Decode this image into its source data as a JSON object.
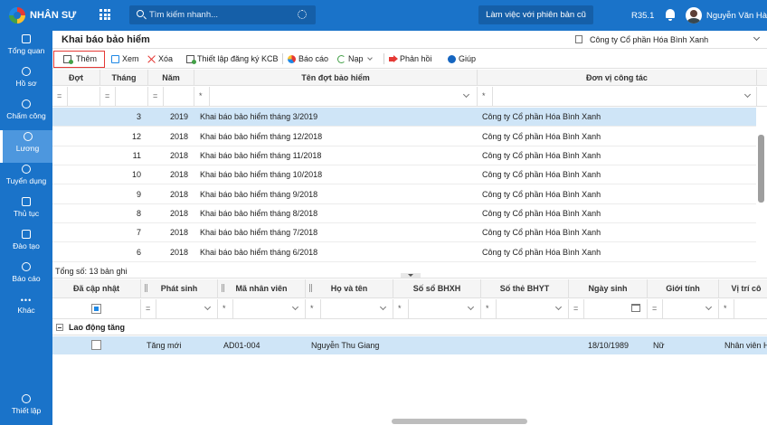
{
  "app": {
    "brand": "NHÂN SỰ",
    "version": "R35.1",
    "user_name": "Nguyễn Văn Hà"
  },
  "search": {
    "placeholder": "Tìm kiếm nhanh..."
  },
  "header": {
    "old_version_button": "Làm việc với phiên bản cũ"
  },
  "sidebar": {
    "items": [
      {
        "label": "Tổng quan",
        "icon": "home-icon"
      },
      {
        "label": "Hồ sơ",
        "icon": "person-icon"
      },
      {
        "label": "Chấm công",
        "icon": "clock-icon"
      },
      {
        "label": "Lương",
        "icon": "dollar-icon",
        "active": true
      },
      {
        "label": "Tuyển dụng",
        "icon": "recruit-icon"
      },
      {
        "label": "Thủ tục",
        "icon": "document-icon"
      },
      {
        "label": "Đào tạo",
        "icon": "training-icon"
      },
      {
        "label": "Báo cáo",
        "icon": "report-icon"
      },
      {
        "label": "Khác",
        "icon": "more-icon"
      },
      {
        "label": "Thiết lập",
        "icon": "settings-icon"
      }
    ]
  },
  "page": {
    "title": "Khai báo bảo hiểm",
    "company": "Công ty Cổ phần Hóa Bình Xanh"
  },
  "toolbar": {
    "add": "Thêm",
    "view": "Xem",
    "delete": "Xóa",
    "setup_kcb": "Thiết lập đăng ký KCB",
    "report": "Báo cáo",
    "load": "Nạp",
    "feedback": "Phản hồi",
    "help": "Giúp"
  },
  "table1": {
    "columns": {
      "dot": "Đợt",
      "thang": "Tháng",
      "nam": "Năm",
      "ten_dot": "Tên đợt bảo hiểm",
      "don_vi": "Đơn vị công tác"
    },
    "filter_eq": "=",
    "filter_star": "*",
    "rows": [
      {
        "thang": "3",
        "nam": "2019",
        "ten": "Khai báo bảo hiểm tháng 3/2019",
        "don_vi": "Công ty Cổ phần Hóa Bình Xanh"
      },
      {
        "thang": "12",
        "nam": "2018",
        "ten": "Khai báo bảo hiểm tháng 12/2018",
        "don_vi": "Công ty Cổ phần Hóa Bình Xanh"
      },
      {
        "thang": "11",
        "nam": "2018",
        "ten": "Khai báo bảo hiểm tháng 11/2018",
        "don_vi": "Công ty Cổ phần Hóa Bình Xanh"
      },
      {
        "thang": "10",
        "nam": "2018",
        "ten": "Khai báo bảo hiểm tháng 10/2018",
        "don_vi": "Công ty Cổ phần Hóa Bình Xanh"
      },
      {
        "thang": "9",
        "nam": "2018",
        "ten": "Khai báo bảo hiểm tháng 9/2018",
        "don_vi": "Công ty Cổ phần Hóa Bình Xanh"
      },
      {
        "thang": "8",
        "nam": "2018",
        "ten": "Khai báo bảo hiểm tháng 8/2018",
        "don_vi": "Công ty Cổ phần Hóa Bình Xanh"
      },
      {
        "thang": "7",
        "nam": "2018",
        "ten": "Khai báo bảo hiểm tháng 7/2018",
        "don_vi": "Công ty Cổ phần Hóa Bình Xanh"
      },
      {
        "thang": "6",
        "nam": "2018",
        "ten": "Khai báo bảo hiểm tháng 6/2018",
        "don_vi": "Công ty Cổ phần Hóa Bình Xanh"
      }
    ],
    "total": "Tổng số: 13 bản ghi"
  },
  "table2": {
    "columns": {
      "da_cap_nhat": "Đã cập nhật",
      "phat_sinh": "Phát sinh",
      "ma_nv": "Mã nhân viên",
      "ho_ten": "Họ và tên",
      "so_bhxh": "Số sổ BHXH",
      "so_bhyt": "Số thẻ BHYT",
      "ngay_sinh": "Ngày sinh",
      "gioi_tinh": "Giới tính",
      "vi_tri": "Vị trí cô"
    },
    "group": "Lao động tăng",
    "row": {
      "phat_sinh": "Tăng mới",
      "ma_nv": "AD01-004",
      "ho_ten": "Nguyễn Thu Giang",
      "ngay_sinh": "18/10/1989",
      "gioi_tinh": "Nữ",
      "vi_tri": "Nhân viên H"
    }
  }
}
